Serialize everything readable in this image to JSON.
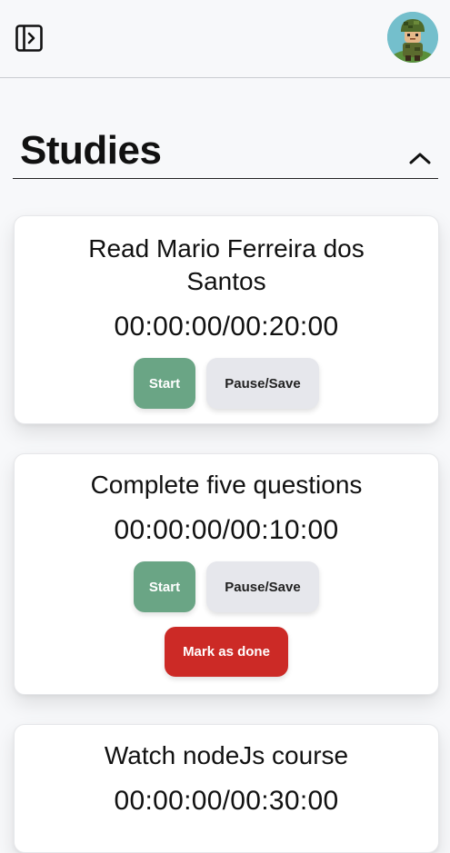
{
  "header": {
    "toggle_icon": "sidebar-toggle-icon",
    "avatar_icon": "soldier-avatar"
  },
  "section": {
    "title": "Studies",
    "collapse_icon": "chevron-up-icon"
  },
  "tasks": [
    {
      "title": "Read Mario Ferreira dos Santos",
      "timer": "00:00:00/00:20:00",
      "start_label": "Start",
      "pause_label": "Pause/Save"
    },
    {
      "title": "Complete five questions",
      "timer": "00:00:00/00:10:00",
      "start_label": "Start",
      "pause_label": "Pause/Save",
      "done_label": "Mark as done"
    },
    {
      "title": "Watch nodeJs course",
      "timer": "00:00:00/00:30:00"
    }
  ],
  "colors": {
    "start": "#6aa585",
    "pause": "#e6e7ec",
    "done": "#cc2a26",
    "background": "#f7f8fa"
  }
}
